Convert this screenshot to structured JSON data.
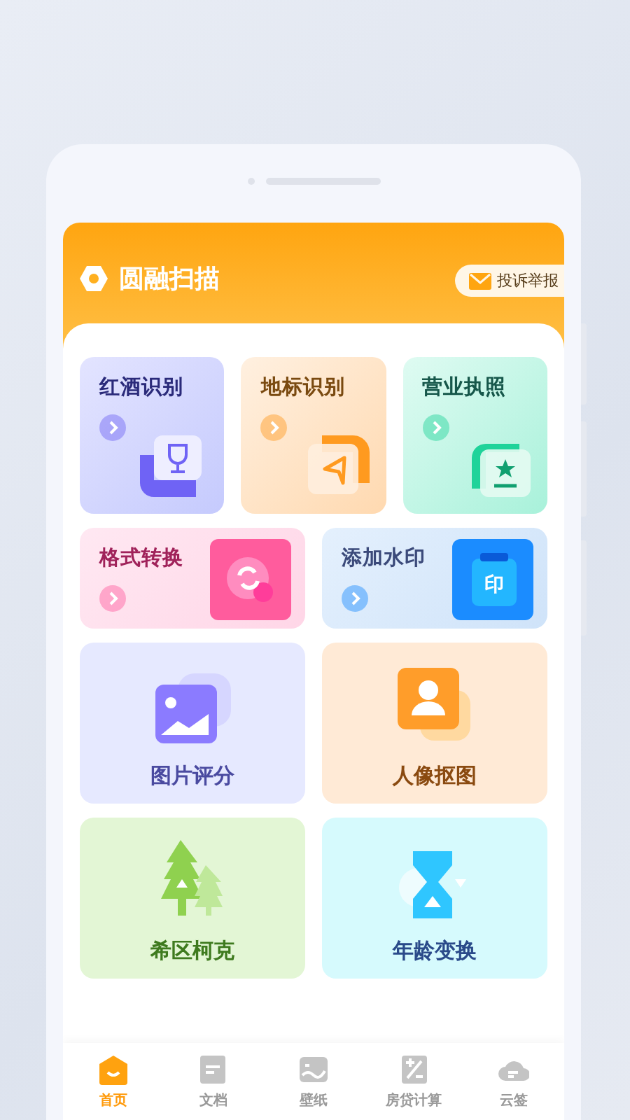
{
  "header": {
    "title": "圆融扫描",
    "report_button": "投诉举报"
  },
  "tiles": [
    {
      "kind": "small",
      "label": "红酒识别",
      "color": "#6f63f5"
    },
    {
      "kind": "small",
      "label": "地标识别",
      "color": "#ff9a1f"
    },
    {
      "kind": "small",
      "label": "营业执照",
      "color": "#1fd39a"
    },
    {
      "kind": "wide",
      "label": "格式转换",
      "color": "#ff5c9d"
    },
    {
      "kind": "wide",
      "label": "添加水印",
      "stamp_text": "印",
      "color": "#1b8cff"
    },
    {
      "kind": "big",
      "label": "图片评分",
      "color": "#8b7bff"
    },
    {
      "kind": "big",
      "label": "人像抠图",
      "color": "#ff9d2a"
    },
    {
      "kind": "big",
      "label": "希区柯克",
      "color": "#8fd14f"
    },
    {
      "kind": "big",
      "label": "年龄变换",
      "color": "#2fc6ff"
    }
  ],
  "tab_bar": [
    {
      "label": "首页",
      "selected": true
    },
    {
      "label": "文档",
      "selected": false
    },
    {
      "label": "壁纸",
      "selected": false
    },
    {
      "label": "房贷计算",
      "selected": false
    },
    {
      "label": "云签",
      "selected": false
    }
  ]
}
